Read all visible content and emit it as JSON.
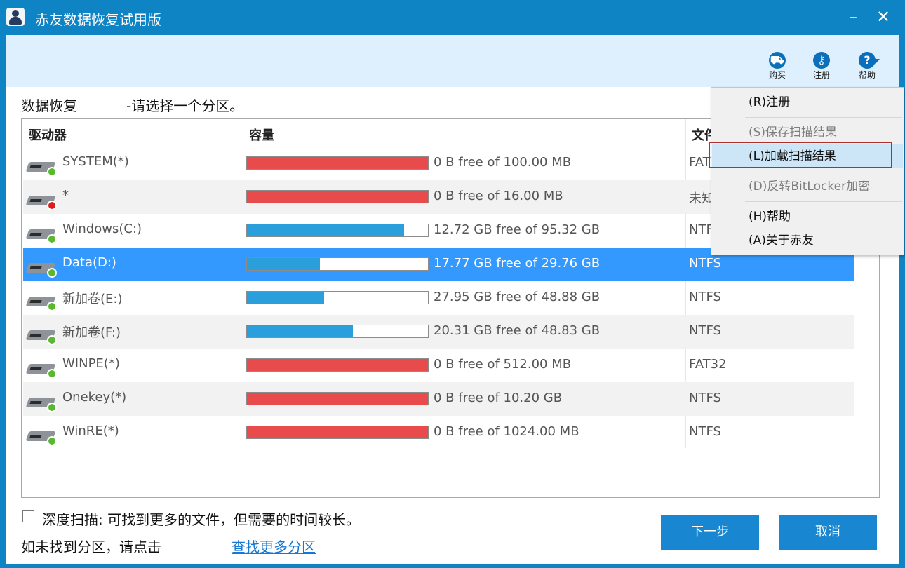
{
  "window": {
    "title": "赤友数据恢复试用版",
    "minimize_glyph": "–",
    "close_glyph": "✕"
  },
  "toolbar": {
    "buy": {
      "label": "购买",
      "icon": "cart-icon",
      "glyph": "⛟"
    },
    "register": {
      "label": "注册",
      "icon": "key-icon",
      "glyph": "⚷"
    },
    "help": {
      "label": "帮助",
      "icon": "help-icon",
      "glyph": "?"
    }
  },
  "page": {
    "heading": "数据恢复",
    "subheading": "-请选择一个分区。"
  },
  "table": {
    "columns": [
      "驱动器",
      "容量",
      "文件系统"
    ],
    "rows": [
      {
        "name": "SYSTEM(*)",
        "capacity": "0 B free of 100.00 MB",
        "used_fraction": 1.0,
        "bar_color": "#e84b4b",
        "fs": "FAT",
        "status": "ok"
      },
      {
        "name": "*",
        "capacity": "0 B free of 16.00 MB",
        "used_fraction": 1.0,
        "bar_color": "#e84b4b",
        "fs": "未知",
        "status": "error"
      },
      {
        "name": "Windows(C:)",
        "capacity": "12.72 GB free of 95.32 GB",
        "used_fraction": 0.867,
        "bar_color": "#2b9fdc",
        "fs": "NTF",
        "status": "ok"
      },
      {
        "name": "Data(D:)",
        "capacity": "17.77 GB free of 29.76 GB",
        "used_fraction": 0.403,
        "bar_color": "#2b9fdc",
        "fs": "NTFS",
        "status": "ok",
        "selected": true
      },
      {
        "name": "新加卷(E:)",
        "capacity": "27.95 GB free of 48.88 GB",
        "used_fraction": 0.428,
        "bar_color": "#2b9fdc",
        "fs": "NTFS",
        "status": "ok"
      },
      {
        "name": "新加卷(F:)",
        "capacity": "20.31 GB free of 48.83 GB",
        "used_fraction": 0.584,
        "bar_color": "#2b9fdc",
        "fs": "NTFS",
        "status": "ok"
      },
      {
        "name": "WINPE(*)",
        "capacity": "0 B free of 512.00 MB",
        "used_fraction": 1.0,
        "bar_color": "#e84b4b",
        "fs": "FAT32",
        "status": "ok"
      },
      {
        "name": "Onekey(*)",
        "capacity": "0 B free of 10.20 GB",
        "used_fraction": 1.0,
        "bar_color": "#e84b4b",
        "fs": "NTFS",
        "status": "ok"
      },
      {
        "name": "WinRE(*)",
        "capacity": "0 B free of 1024.00 MB",
        "used_fraction": 1.0,
        "bar_color": "#e84b4b",
        "fs": "NTFS",
        "status": "ok"
      }
    ]
  },
  "menu": {
    "items": [
      {
        "label": "(R)注册",
        "enabled": true
      },
      {
        "label": "(S)保存扫描结果",
        "enabled": false
      },
      {
        "label": "(L)加载扫描结果",
        "enabled": true,
        "highlighted": true
      },
      {
        "label": "(D)反转BitLocker加密",
        "enabled": false
      },
      {
        "label": "(H)帮助",
        "enabled": true
      },
      {
        "label": "(A)关于赤友",
        "enabled": true
      }
    ]
  },
  "footer": {
    "deep_scan_label": "深度扫描: 可找到更多的文件，但需要的时间较长。",
    "deep_scan_checked": false,
    "hint": "如未找到分区，请点击",
    "find_link": "查找更多分区",
    "next_button": "下一步",
    "cancel_button": "取消"
  }
}
